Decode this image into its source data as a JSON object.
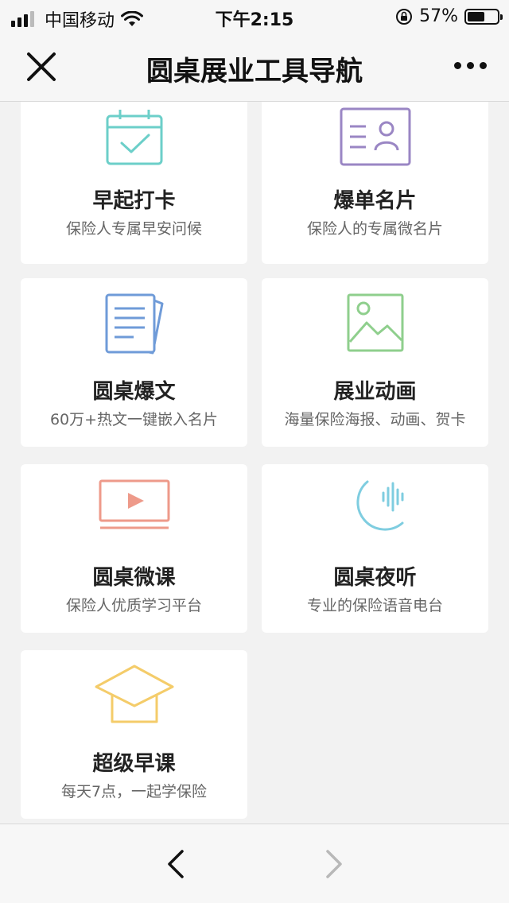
{
  "status_bar": {
    "carrier": "中国移动",
    "time": "下午2:15",
    "battery": "57%",
    "battery_level": 0.57
  },
  "nav": {
    "title": "圆桌展业工具导航"
  },
  "cards": [
    {
      "title": "早起打卡",
      "subtitle": "保险人专属早安问候",
      "icon": "calendar-check-icon",
      "color": "#6ccfc9"
    },
    {
      "title": "爆单名片",
      "subtitle": "保险人的专属微名片",
      "icon": "business-card-icon",
      "color": "#9a86c4"
    },
    {
      "title": "圆桌爆文",
      "subtitle": "60万+热文一键嵌入名片",
      "icon": "document-icon",
      "color": "#6f9bd8"
    },
    {
      "title": "展业动画",
      "subtitle": "海量保险海报、动画、贺卡",
      "icon": "image-icon",
      "color": "#8fcf8d"
    },
    {
      "title": "圆桌微课",
      "subtitle": "保险人优质学习平台",
      "icon": "video-play-icon",
      "color": "#ee9a8a"
    },
    {
      "title": "圆桌夜听",
      "subtitle": "专业的保险语音电台",
      "icon": "moon-audio-icon",
      "color": "#7fcde0"
    },
    {
      "title": "超级早课",
      "subtitle": "每天7点，一起学保险",
      "icon": "graduation-cap-icon",
      "color": "#f4cc6a"
    }
  ]
}
